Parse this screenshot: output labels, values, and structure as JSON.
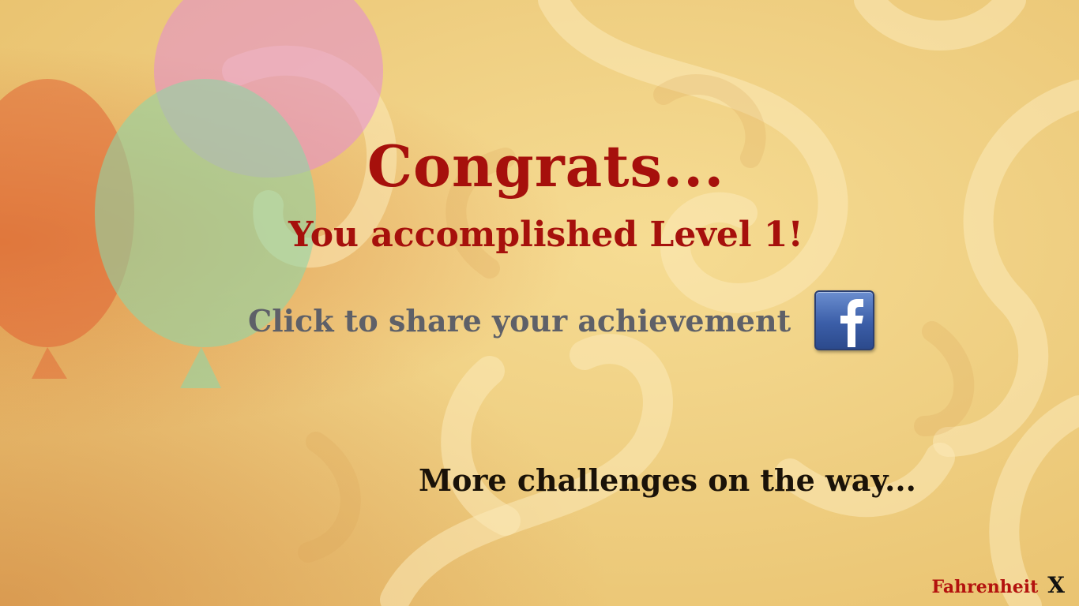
{
  "screen": {
    "title": "Congrats...",
    "subtitle": "You accomplished Level 1!",
    "share_prompt": "Click to share your achievement",
    "share_icon": "facebook-icon",
    "more_text": "More challenges on the way..."
  },
  "footer": {
    "brand": "Fahrenheit",
    "close_label": "X"
  },
  "colors": {
    "title": "#a6100c",
    "share_text": "#5e6068",
    "background": "#efcf82",
    "facebook_blue": "#3b5ea8"
  }
}
